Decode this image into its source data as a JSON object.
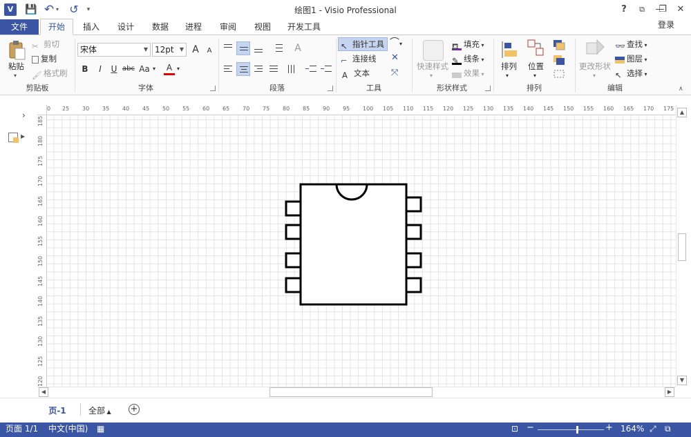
{
  "window": {
    "title": "绘图1 - Visio Professional",
    "app_icon": "V",
    "help": "?",
    "minimize": "—",
    "restore": "❐",
    "close": "✕",
    "ribbon_options": "⧉"
  },
  "qat": {
    "save": "💾",
    "undo": "↶",
    "redo": "↺",
    "customize": "▾"
  },
  "tabs": {
    "file": "文件",
    "active": "开始",
    "items": [
      "插入",
      "设计",
      "数据",
      "进程",
      "审阅",
      "视图",
      "开发工具"
    ],
    "login": "登录"
  },
  "ribbon": {
    "clipboard": {
      "paste": "粘贴",
      "cut": "剪切",
      "copy": "复制",
      "format_painter": "格式刷",
      "label": "剪贴板"
    },
    "font": {
      "family": "宋体",
      "size": "12pt",
      "grow": "A",
      "shrink": "A",
      "bold": "B",
      "italic": "I",
      "underline": "U",
      "strike": "abc",
      "case": "Aa",
      "color_a": "A",
      "label": "字体"
    },
    "paragraph": {
      "label": "段落",
      "rotate_text": "A"
    },
    "tools": {
      "pointer": "指针工具",
      "connector": "连接线",
      "text": "文本",
      "label": "工具",
      "text_icon": "A",
      "close_x": "✕"
    },
    "shape_styles": {
      "quick": "快速样式",
      "fill": "填充",
      "line": "线条",
      "effects": "效果",
      "label": "形状样式"
    },
    "arrange": {
      "align": "排列",
      "position": "位置",
      "label": "排列"
    },
    "edit": {
      "change_shape": "更改形状",
      "find": "查找",
      "layers": "图层",
      "select": "选择",
      "label": "编辑"
    }
  },
  "ruler": {
    "top_ticks": [
      "0",
      "25",
      "30",
      "35",
      "40",
      "45",
      "50",
      "55",
      "60",
      "65",
      "70",
      "75",
      "80",
      "85",
      "90",
      "95",
      "100",
      "105",
      "110",
      "115",
      "120",
      "125",
      "130",
      "135",
      "140",
      "145",
      "150",
      "155",
      "160",
      "165",
      "170",
      "175"
    ],
    "left_ticks": [
      "185",
      "180",
      "175",
      "170",
      "165",
      "160",
      "155",
      "150",
      "145",
      "140",
      "135",
      "130",
      "125",
      "120"
    ]
  },
  "pages": {
    "current": "页-1",
    "all": "全部",
    "add": "+"
  },
  "status": {
    "page": "页面 1/1",
    "language": "中文(中国)",
    "zoom": "164%",
    "zoom_minus": "−",
    "zoom_plus": "+"
  },
  "colors": {
    "accent": "#3955a3",
    "font_color_bar": "#e00000",
    "shape_stroke": "#000000"
  }
}
